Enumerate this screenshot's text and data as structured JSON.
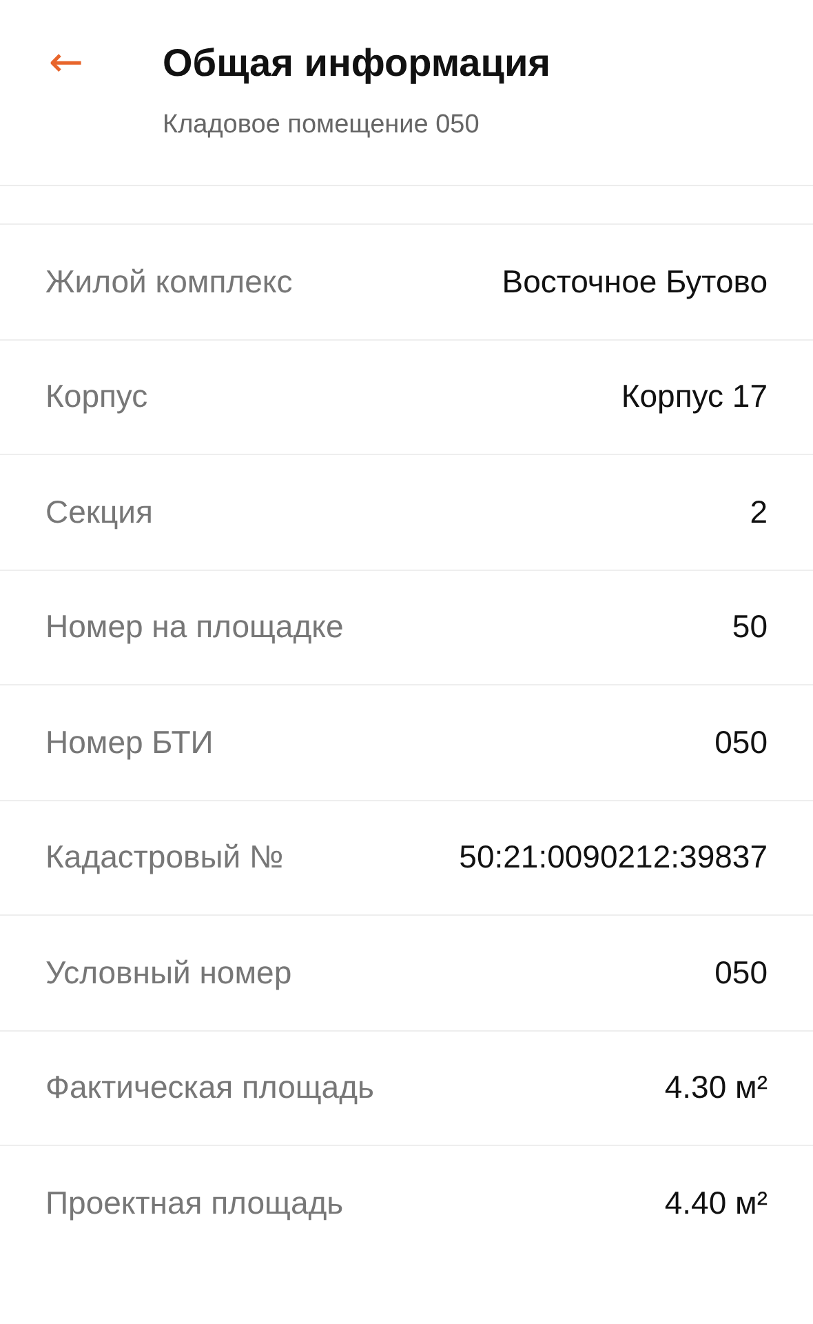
{
  "header": {
    "back": "←",
    "title": "Общая информация",
    "subtitle": "Кладовое помещение 050"
  },
  "rows": [
    {
      "label": "Жилой комплекс",
      "value": "Восточное Бутово"
    },
    {
      "label": "Корпус",
      "value": "Корпус 17"
    },
    {
      "label": "Секция",
      "value": "2"
    },
    {
      "label": "Номер на площадке",
      "value": "50"
    },
    {
      "label": "Номер БТИ",
      "value": "050"
    },
    {
      "label": "Кадастровый №",
      "value": "50:21:0090212:39837"
    },
    {
      "label": "Условный номер",
      "value": "050"
    },
    {
      "label": "Фактическая площадь",
      "value": "4.30 м²"
    },
    {
      "label": "Проектная площадь",
      "value": "4.40 м²"
    }
  ]
}
